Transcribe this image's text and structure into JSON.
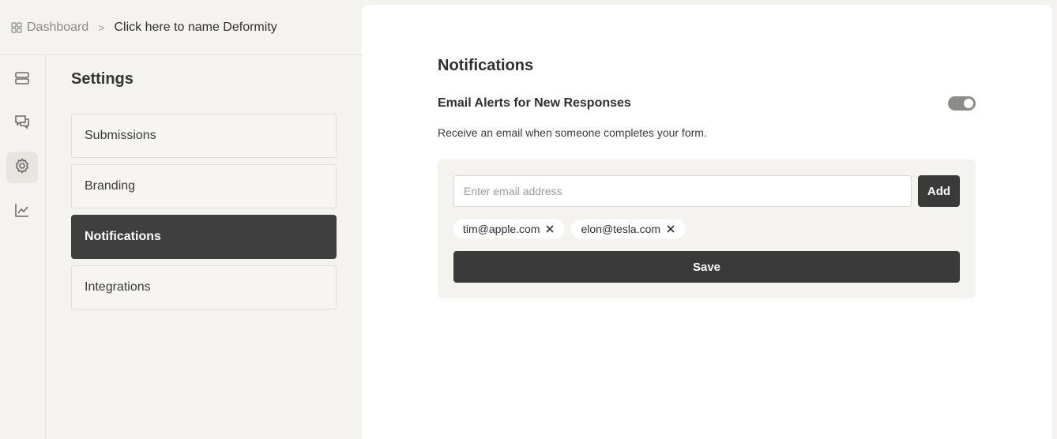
{
  "breadcrumb": {
    "icon": "grid-icon",
    "dashboard_label": "Dashboard",
    "separator": ">",
    "form_name": "Click here to name Deformity"
  },
  "rail": {
    "items": [
      {
        "icon": "layers-icon",
        "active": false
      },
      {
        "icon": "chat-icon",
        "active": false
      },
      {
        "icon": "gear-icon",
        "active": true
      },
      {
        "icon": "chart-icon",
        "active": false
      }
    ]
  },
  "settings": {
    "title": "Settings",
    "items": [
      {
        "label": "Submissions",
        "active": false
      },
      {
        "label": "Branding",
        "active": false
      },
      {
        "label": "Notifications",
        "active": true
      },
      {
        "label": "Integrations",
        "active": false
      }
    ]
  },
  "notifications": {
    "title": "Notifications",
    "email_alerts_label": "Email Alerts for New Responses",
    "email_alerts_enabled": true,
    "description": "Receive an email when someone completes your form.",
    "email_input_placeholder": "Enter email address",
    "email_input_value": "",
    "add_label": "Add",
    "emails": [
      "tim@apple.com",
      "elon@tesla.com"
    ],
    "save_label": "Save"
  },
  "colors": {
    "background": "#f4f3ef",
    "panel": "#ffffff",
    "active_item": "#3f3f3f",
    "button": "#3a3a3a",
    "toggle_on": "#8c8c89"
  }
}
